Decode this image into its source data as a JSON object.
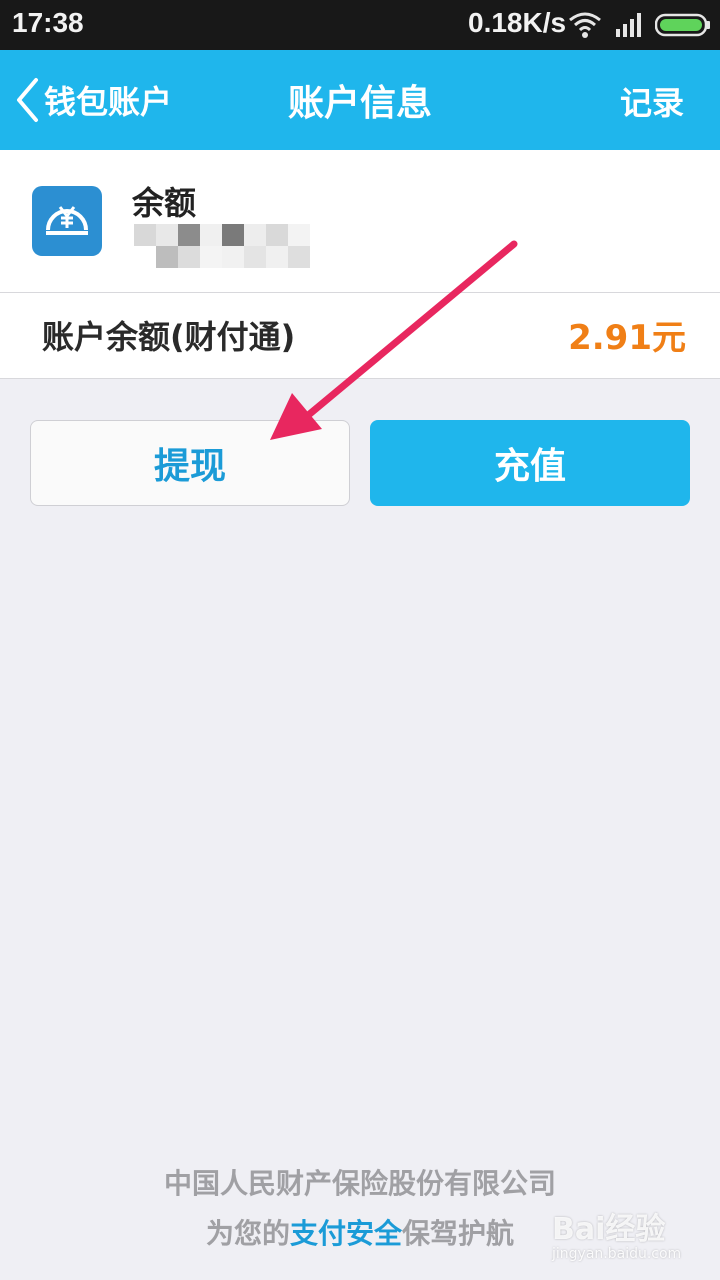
{
  "status_bar": {
    "time": "17:38",
    "net_speed": "0.18K/s",
    "icons": [
      "wifi-icon",
      "signal-icon",
      "battery-icon"
    ]
  },
  "nav": {
    "back_label": "钱包账户",
    "title": "账户信息",
    "record_label": "记录"
  },
  "account": {
    "icon": "yuan-coin-icon",
    "name": "余额",
    "balance_label": "账户余额(财付通)",
    "balance_value": "2.91元"
  },
  "actions": {
    "withdraw_label": "提现",
    "recharge_label": "充值"
  },
  "footer": {
    "line1": "中国人民财产保险股份有限公司",
    "line2_prefix": "为您的",
    "line2_highlight": "支付安全",
    "line2_suffix": "保驾护航"
  },
  "watermark": {
    "brand": "Bai经验",
    "url": "jingyan.baidu.com"
  },
  "colors": {
    "accent": "#1fb6ec",
    "balance": "#f07f16",
    "annotation_arrow": "#e8275f"
  }
}
